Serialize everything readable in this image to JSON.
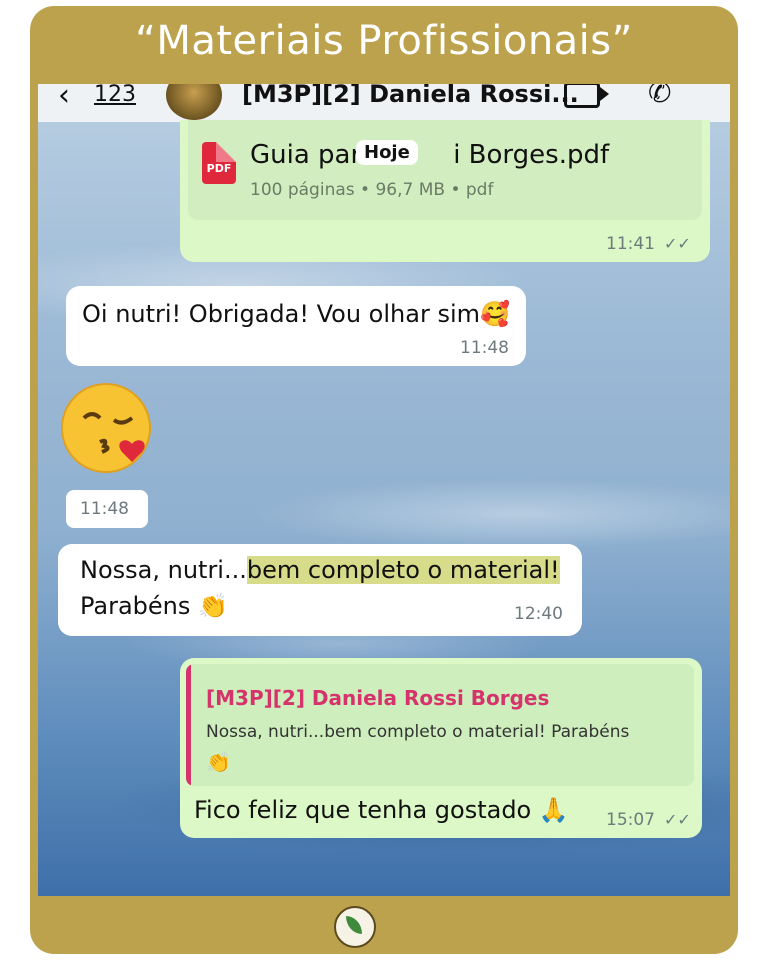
{
  "banner": {
    "title": "“Materiais Profissionais”"
  },
  "header": {
    "back_count": "123",
    "chat_title": "[M3P][2] Daniela Rossi...",
    "back_icon": "chevron-left-icon",
    "video_icon": "video-call-icon",
    "phone_icon": "phone-call-icon"
  },
  "messages": {
    "doc": {
      "file_name": "Guia para Dani Borges.pdf",
      "file_name_visible_left": "Guia par",
      "file_name_visible_right": "i Borges.pdf",
      "meta": "100 páginas • 96,7 MB • pdf",
      "icon_label": "PDF",
      "time": "11:41",
      "date_chip": "Hoje"
    },
    "msg1": {
      "text": "Oi nutri! Obrigada! Vou olhar sim🥰",
      "time": "11:48"
    },
    "emoji": {
      "glyph": "😘",
      "time": "11:48"
    },
    "msg2": {
      "text_a": "Nossa, nutri...",
      "text_highlight": "bem completo o material!",
      "text_b": "Parabéns 👏",
      "time": "12:40"
    },
    "reply": {
      "quote_author": "[M3P][2] Daniela Rossi Borges",
      "quote_text": "Nossa, nutri...bem completo o material! Parabéns",
      "quote_emoji": "👏",
      "text": "Fico feliz que tenha gostado 🙏",
      "time": "15:07"
    }
  },
  "colors": {
    "frame": "#bda24e",
    "outgoing_bubble": "#dcf8c6",
    "incoming_bubble": "#ffffff",
    "quote_accent": "#d6336c",
    "highlight": "#d6dc8a"
  }
}
